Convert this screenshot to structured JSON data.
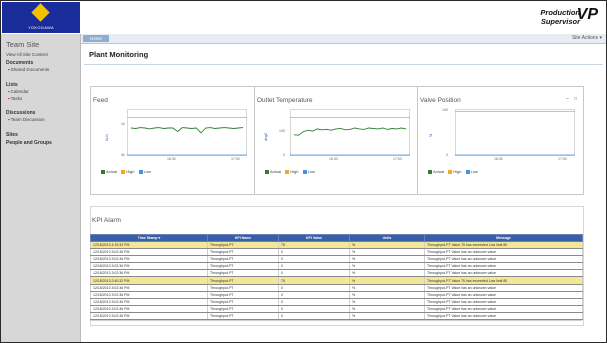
{
  "header": {
    "logo_text": "YOKOGAWA",
    "brand_line1": "Production",
    "brand_line2": "Supervisor",
    "brand_mark": "VP"
  },
  "sidebar": {
    "title": "Team Site",
    "view_all": "View All Site Content",
    "sections": [
      {
        "heading": "Documents",
        "items": [
          "Shared Documents"
        ]
      },
      {
        "heading": "Lists",
        "items": [
          "Calendar",
          "Tasks"
        ]
      },
      {
        "heading": "Discussions",
        "items": [
          "Team Discussion"
        ]
      },
      {
        "heading": "Sites",
        "items": []
      },
      {
        "heading": "People and Groups",
        "items": []
      }
    ]
  },
  "tabbar": {
    "home_label": "Home",
    "site_actions": "Site Actions",
    "site_actions_icon": "chevron-down-icon"
  },
  "page": {
    "title": "Plant Monitoring"
  },
  "panel_controls": {
    "minimize_icon": "minimize-icon",
    "maximize_icon": "maximize-icon"
  },
  "legend": {
    "actual": "Actual",
    "high": "High",
    "low": "Low"
  },
  "colors": {
    "actual": "#2e7d32",
    "high": "#f5a623",
    "low": "#4a90e2",
    "table_header": "#3a5faa",
    "highlight_row": "#f1e796"
  },
  "charts": [
    {
      "id": "feed",
      "title": "Feed",
      "ylabel": "kL/h",
      "yticks": [
        "1k",
        "0k"
      ],
      "xticks": [
        "16:30",
        "17:00"
      ],
      "high_level": 0.83,
      "low_level": 0.0,
      "actual": [
        0.6,
        0.59,
        0.61,
        0.6,
        0.58,
        0.6,
        0.61,
        0.59,
        0.6,
        0.6,
        0.52,
        0.61,
        0.6,
        0.59,
        0.6,
        0.49,
        0.6,
        0.61,
        0.59,
        0.6,
        0.61,
        0.6,
        0.59,
        0.6,
        0.61
      ]
    },
    {
      "id": "outlet-temp",
      "title": "Outlet Temperature",
      "ylabel": "degC",
      "yticks": [
        "100",
        "0"
      ],
      "xticks": [
        "16:30",
        "17:00"
      ],
      "high_level": 0.83,
      "low_level": 0.0,
      "actual": [
        0.45,
        0.44,
        0.52,
        0.55,
        0.53,
        0.58,
        0.56,
        0.57,
        0.55,
        0.58,
        0.59,
        0.56,
        0.57,
        0.6,
        0.58,
        0.57,
        0.6,
        0.59,
        0.58,
        0.6,
        0.57,
        0.59,
        0.58,
        0.6,
        0.58
      ]
    },
    {
      "id": "valve-position",
      "title": "Valve Position",
      "ylabel": "%",
      "yticks": [
        "100",
        "0"
      ],
      "xticks": [
        "16:30",
        "17:00"
      ],
      "high_level": 0.97,
      "low_level": 0.0,
      "actual": []
    }
  ],
  "kpi": {
    "title": "KPI Alarm",
    "columns": [
      "Time Stamp",
      "KPI Name",
      "KPI Value",
      "Units",
      "Message"
    ],
    "rows": [
      {
        "ts": "12/18/2013 4:15:32 PM",
        "name": "Throughput-PT",
        "value": "75",
        "units": "%",
        "msg": "Throughput-PT Value 75 has exceeded Low limit 80",
        "hl": true
      },
      {
        "ts": "12/18/2013 3:02:36 PM",
        "name": "Throughput-PT",
        "value": "0",
        "units": "%",
        "msg": "Throughput-PT Value has an unknown value",
        "hl": false
      },
      {
        "ts": "12/18/2013 3:02:36 PM",
        "name": "Throughput-PT",
        "value": "0",
        "units": "%",
        "msg": "Throughput-PT Value has an unknown value",
        "hl": false
      },
      {
        "ts": "12/18/2013 3:02:36 PM",
        "name": "Throughput-PT",
        "value": "0",
        "units": "%",
        "msg": "Throughput-PT Value has an unknown value",
        "hl": false
      },
      {
        "ts": "12/18/2013 3:02:36 PM",
        "name": "Throughput-PT",
        "value": "0",
        "units": "%",
        "msg": "Throughput-PT Value has an unknown value",
        "hl": false
      },
      {
        "ts": "12/18/2013 2:40:32 PM",
        "name": "Throughput-PT",
        "value": "75",
        "units": "%",
        "msg": "Throughput-PT Value 75 has exceeded Low limit 80",
        "hl": true
      },
      {
        "ts": "12/18/2013 3:02:36 PM",
        "name": "Throughput-PT",
        "value": "0",
        "units": "%",
        "msg": "Throughput-PT Value has an unknown value",
        "hl": false
      },
      {
        "ts": "12/18/2013 3:02:36 PM",
        "name": "Throughput-PT",
        "value": "0",
        "units": "%",
        "msg": "Throughput-PT Value has an unknown value",
        "hl": false
      },
      {
        "ts": "12/18/2013 3:02:36 PM",
        "name": "Throughput-PT",
        "value": "0",
        "units": "%",
        "msg": "Throughput-PT Value has an unknown value",
        "hl": false
      },
      {
        "ts": "12/18/2013 3:02:36 PM",
        "name": "Throughput-PT",
        "value": "0",
        "units": "%",
        "msg": "Throughput-PT Value has an unknown value",
        "hl": false
      },
      {
        "ts": "12/18/2013 3:02:36 PM",
        "name": "Throughput-PT",
        "value": "0",
        "units": "%",
        "msg": "Throughput-PT Value has an unknown value",
        "hl": false
      }
    ]
  }
}
